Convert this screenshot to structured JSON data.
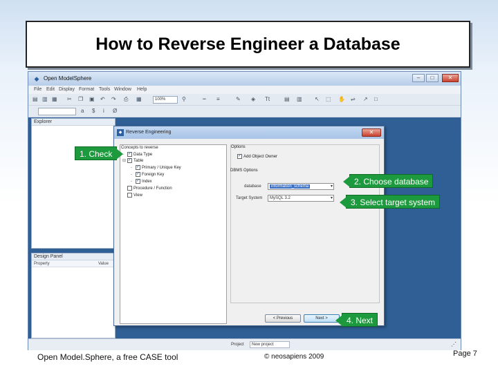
{
  "slide": {
    "title": "How to Reverse Engineer a Database",
    "footer_left": "Open Model.Sphere, a free CASE tool",
    "footer_center": "© neosapiens 2009",
    "footer_right": "Page 7"
  },
  "app": {
    "title": "Open ModelSphere",
    "menu": [
      "File",
      "Edit",
      "Display",
      "Format",
      "Tools",
      "Window",
      "Help"
    ],
    "zoom": "100%",
    "explorer_title": "Explorer",
    "design_panel_title": "Design Panel",
    "design_cols": [
      "Property",
      "Value"
    ],
    "status_label": "Project",
    "status_value": "New project"
  },
  "dialog": {
    "title": "Reverse Engineering",
    "concepts_label": "Concepts to reverse",
    "concepts": [
      {
        "label": "Data Type",
        "checked": true,
        "level": 1
      },
      {
        "label": "Table",
        "checked": true,
        "level": 1
      },
      {
        "label": "Primary / Unique Key",
        "checked": true,
        "level": 2
      },
      {
        "label": "Foreign Key",
        "checked": true,
        "level": 2
      },
      {
        "label": "Index",
        "checked": true,
        "level": 2
      },
      {
        "label": "Procedure / Function",
        "checked": false,
        "level": 1
      },
      {
        "label": "View",
        "checked": false,
        "level": 1
      }
    ],
    "options_label": "Options",
    "add_owner": "Add Object Owner",
    "dbms_label": "DBMS Options",
    "database_label": "database",
    "database_value": "information_schema",
    "target_label": "Target System",
    "target_value": "MySQL 3.2",
    "btn_previous": "< Previous",
    "btn_next": "Next >"
  },
  "callouts": {
    "c1": "1. Check",
    "c2": "2. Choose database",
    "c3": "3. Select target system",
    "c4": "4. Next"
  },
  "colors": {
    "callout": "#1e9a3e",
    "app_background": "#2f5f95"
  }
}
